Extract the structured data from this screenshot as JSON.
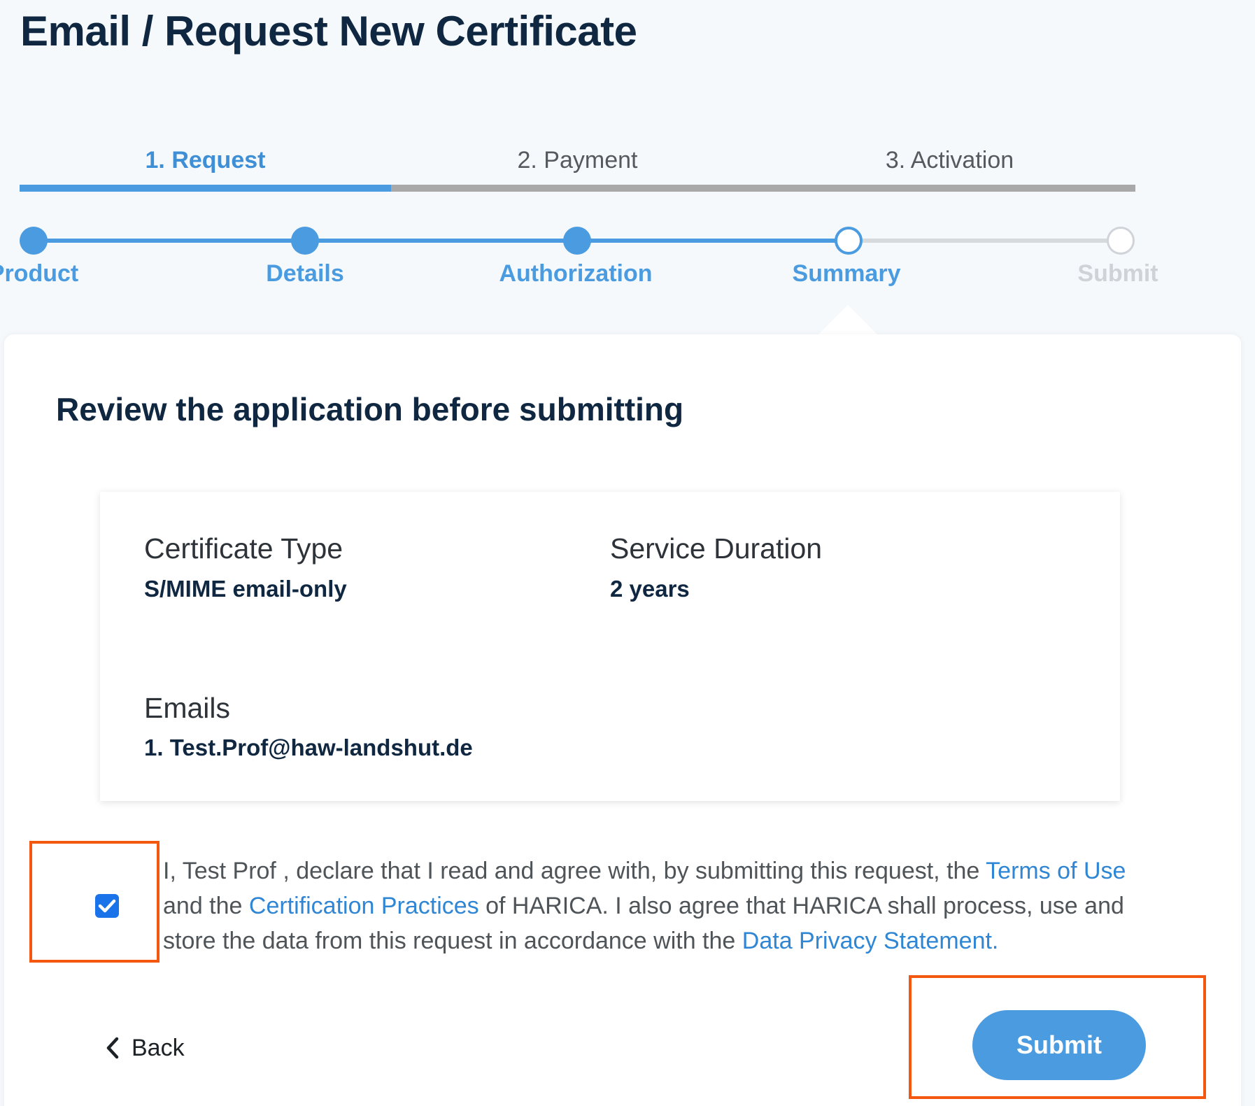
{
  "page": {
    "title": "Email / Request New Certificate"
  },
  "main_tabs": [
    {
      "label": "1. Request",
      "state": "active"
    },
    {
      "label": "2. Payment",
      "state": "inactive"
    },
    {
      "label": "3. Activation",
      "state": "inactive"
    }
  ],
  "stepper": {
    "steps": [
      {
        "label": "Product",
        "state": "done"
      },
      {
        "label": "Details",
        "state": "done"
      },
      {
        "label": "Authorization",
        "state": "done"
      },
      {
        "label": "Summary",
        "state": "current"
      },
      {
        "label": "Submit",
        "state": "todo"
      }
    ]
  },
  "card": {
    "heading": "Review the application before submitting",
    "certificate_type": {
      "label": "Certificate Type",
      "value": "S/MIME email-only"
    },
    "service_duration": {
      "label": "Service Duration",
      "value": "2 years"
    },
    "emails": {
      "label": "Emails",
      "values": [
        "1. Test.Prof@haw-landshut.de"
      ]
    }
  },
  "declaration": {
    "checked": true,
    "text_1": "I, Test Prof , declare that I read and agree with, by submitting this request, the ",
    "terms_link": "Terms of Use",
    "text_2": " and the ",
    "practices_link": "Certification Practices",
    "text_3": " of HARICA. I also agree that HARICA shall process, use and store the data from this request in accordance with the ",
    "privacy_link": "Data Privacy Statement."
  },
  "actions": {
    "back_label": "Back",
    "submit_label": "Submit"
  },
  "colors": {
    "accent": "#4a9be0",
    "link": "#2f86d4",
    "heading": "#0f2740",
    "highlight": "#f4570f",
    "checkbox": "#1a73e8"
  },
  "icons": {
    "checkbox_check": "check-icon",
    "back": "chevron-left-icon"
  }
}
